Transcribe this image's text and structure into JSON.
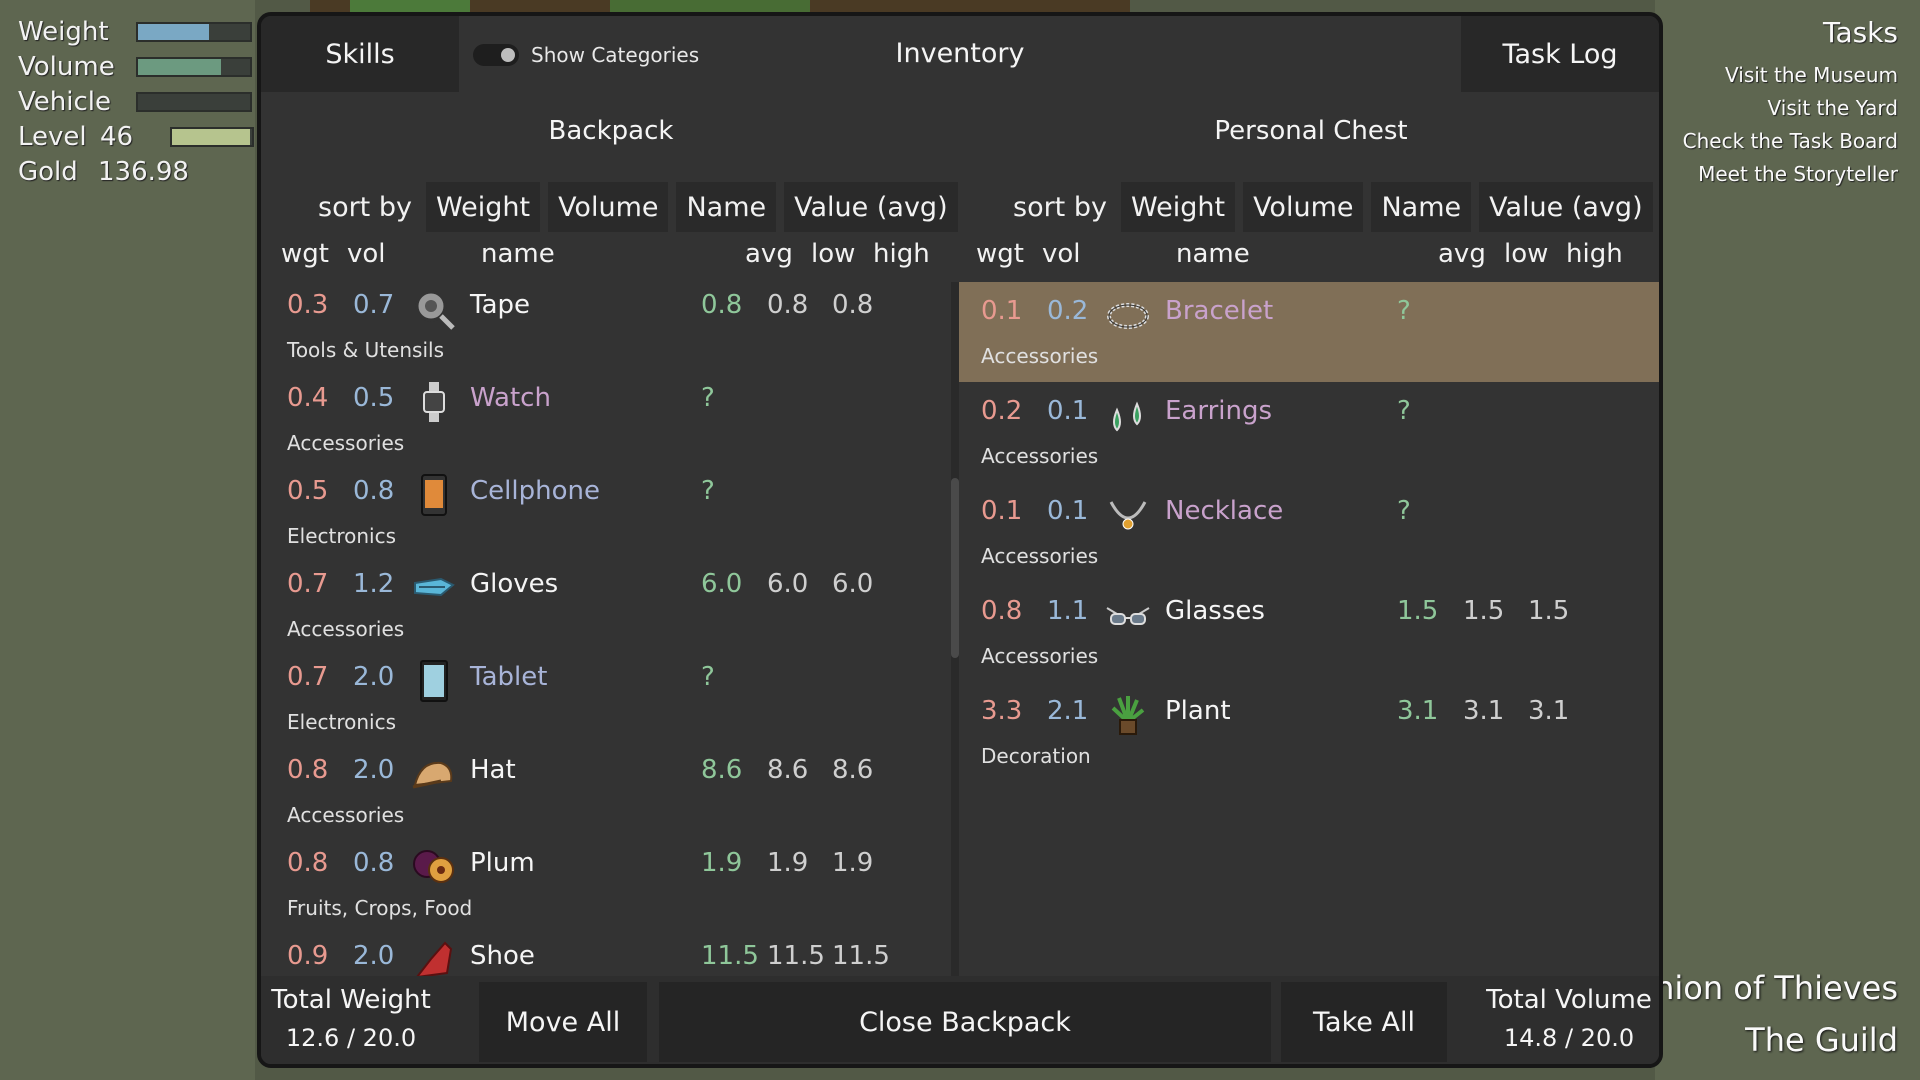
{
  "hud": {
    "weight_label": "Weight",
    "volume_label": "Volume",
    "vehicle_label": "Vehicle",
    "level_label": "Level",
    "level_value": "46",
    "gold_label": "Gold",
    "gold_value": "136.98",
    "weight_fill": 0.63,
    "volume_fill": 0.74,
    "vehicle_fill": 0.0,
    "level_fill": 0.98,
    "colors": {
      "weight": "#7aa8c4",
      "volume": "#6c9a80",
      "level": "#b6c48e"
    }
  },
  "tasks": {
    "title": "Tasks",
    "items": [
      "Visit the Museum",
      "Visit the Yard",
      "Check the Task Board",
      "Meet the Storyteller"
    ]
  },
  "guild": {
    "line1": "Union of Thieves",
    "line2": "The Guild"
  },
  "panel": {
    "skills_tab": "Skills",
    "show_categories": "Show Categories",
    "title": "Inventory",
    "task_log_tab": "Task Log"
  },
  "backpack": {
    "title": "Backpack",
    "sort_label": "sort by",
    "sort_options": [
      "Weight",
      "Volume",
      "Name",
      "Value (avg)"
    ],
    "headers": {
      "wgt": "wgt",
      "vol": "vol",
      "name": "name",
      "avg": "avg",
      "low": "low",
      "high": "high"
    },
    "items": [
      {
        "wgt": "0.3",
        "vol": "0.7",
        "name": "Tape",
        "category": "Tools & Utensils",
        "avg": "0.8",
        "low": "0.8",
        "high": "0.8",
        "icon": "tape-icon",
        "name_style": "normal"
      },
      {
        "wgt": "0.4",
        "vol": "0.5",
        "name": "Watch",
        "category": "Accessories",
        "avg": "?",
        "low": "",
        "high": "",
        "icon": "watch-icon",
        "name_style": "unknown"
      },
      {
        "wgt": "0.5",
        "vol": "0.8",
        "name": "Cellphone",
        "category": "Electronics",
        "avg": "?",
        "low": "",
        "high": "",
        "icon": "cellphone-icon",
        "name_style": "blue"
      },
      {
        "wgt": "0.7",
        "vol": "1.2",
        "name": "Gloves",
        "category": "Accessories",
        "avg": "6.0",
        "low": "6.0",
        "high": "6.0",
        "icon": "gloves-icon",
        "name_style": "normal"
      },
      {
        "wgt": "0.7",
        "vol": "2.0",
        "name": "Tablet",
        "category": "Electronics",
        "avg": "?",
        "low": "",
        "high": "",
        "icon": "tablet-icon",
        "name_style": "blue"
      },
      {
        "wgt": "0.8",
        "vol": "2.0",
        "name": "Hat",
        "category": "Accessories",
        "avg": "8.6",
        "low": "8.6",
        "high": "8.6",
        "icon": "hat-icon",
        "name_style": "normal"
      },
      {
        "wgt": "0.8",
        "vol": "0.8",
        "name": "Plum",
        "category": "Fruits, Crops, Food",
        "avg": "1.9",
        "low": "1.9",
        "high": "1.9",
        "icon": "plum-icon",
        "name_style": "normal"
      },
      {
        "wgt": "0.9",
        "vol": "2.0",
        "name": "Shoe",
        "category": "",
        "avg": "11.5",
        "low": "11.5",
        "high": "11.5",
        "icon": "shoe-icon",
        "name_style": "normal"
      }
    ]
  },
  "chest": {
    "title": "Personal Chest",
    "sort_label": "sort by",
    "sort_options": [
      "Weight",
      "Volume",
      "Name",
      "Value (avg)"
    ],
    "headers": {
      "wgt": "wgt",
      "vol": "vol",
      "name": "name",
      "avg": "avg",
      "low": "low",
      "high": "high"
    },
    "items": [
      {
        "wgt": "0.1",
        "vol": "0.2",
        "name": "Bracelet",
        "category": "Accessories",
        "avg": "?",
        "low": "",
        "high": "",
        "icon": "bracelet-icon",
        "name_style": "unknown",
        "selected": true
      },
      {
        "wgt": "0.2",
        "vol": "0.1",
        "name": "Earrings",
        "category": "Accessories",
        "avg": "?",
        "low": "",
        "high": "",
        "icon": "earrings-icon",
        "name_style": "unknown"
      },
      {
        "wgt": "0.1",
        "vol": "0.1",
        "name": "Necklace",
        "category": "Accessories",
        "avg": "?",
        "low": "",
        "high": "",
        "icon": "necklace-icon",
        "name_style": "unknown"
      },
      {
        "wgt": "0.8",
        "vol": "1.1",
        "name": "Glasses",
        "category": "Accessories",
        "avg": "1.5",
        "low": "1.5",
        "high": "1.5",
        "icon": "glasses-icon",
        "name_style": "normal"
      },
      {
        "wgt": "3.3",
        "vol": "2.1",
        "name": "Plant",
        "category": "Decoration",
        "avg": "3.1",
        "low": "3.1",
        "high": "3.1",
        "icon": "plant-icon",
        "name_style": "normal"
      }
    ]
  },
  "footer": {
    "total_weight_label": "Total Weight",
    "total_weight_value": "12.6 / 20.0",
    "move_all": "Move All",
    "close_backpack": "Close Backpack",
    "take_all": "Take All",
    "total_volume_label": "Total Volume",
    "total_volume_value": "14.8 / 20.0"
  }
}
